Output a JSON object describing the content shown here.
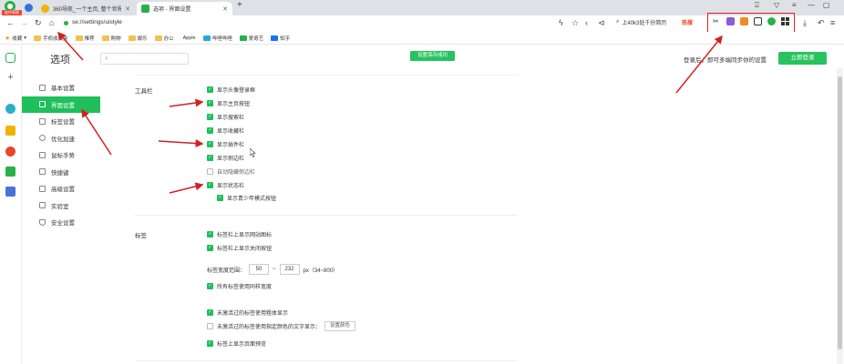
{
  "tabs": [
    {
      "title": "360导航_一个主页, 整个世界",
      "active": false
    },
    {
      "title": "选项 - 界面设置",
      "active": true
    }
  ],
  "browser_badge": "软件帮帮",
  "new_tab_symbol": "+",
  "address": "se://settings/uistyle",
  "search_box": "上40k3处千份简历",
  "hot_label": "热搜",
  "bookmarks": [
    {
      "label": "收藏",
      "type": "star"
    },
    {
      "label": "手机收藏夹",
      "type": "folder"
    },
    {
      "label": "推荐",
      "type": "folder"
    },
    {
      "label": "购物",
      "type": "folder"
    },
    {
      "label": "娱乐",
      "type": "folder"
    },
    {
      "label": "办公",
      "type": "folder"
    },
    {
      "label": "Apple",
      "type": "apple"
    },
    {
      "label": "哔哩哔哩",
      "type": "site"
    },
    {
      "label": "爱奇艺",
      "type": "site"
    },
    {
      "label": "知乎",
      "type": "site"
    }
  ],
  "settings": {
    "title": "选项",
    "search_placeholder": "",
    "save_toast": "设置保存成功",
    "login_tip": "登录后，即可多端同步你的设置",
    "login_button": "立即登录"
  },
  "nav": [
    {
      "label": "基本设置",
      "active": false
    },
    {
      "label": "界面设置",
      "active": true
    },
    {
      "label": "标签设置",
      "active": false
    },
    {
      "label": "优化加速",
      "active": false
    },
    {
      "label": "鼠标手势",
      "active": false
    },
    {
      "label": "快捷键",
      "active": false
    },
    {
      "label": "高级设置",
      "active": false
    },
    {
      "label": "实验室",
      "active": false
    },
    {
      "label": "安全设置",
      "active": false
    }
  ],
  "toolbar_section": {
    "label": "工具栏",
    "options": [
      {
        "label": "显示头像登录框",
        "checked": true
      },
      {
        "label": "显示主页按钮",
        "checked": true
      },
      {
        "label": "显示搜索栏",
        "checked": true
      },
      {
        "label": "显示收藏栏",
        "checked": true
      },
      {
        "label": "显示插件栏",
        "checked": true
      },
      {
        "label": "显示侧边栏",
        "checked": true
      },
      {
        "label": "自动隐藏侧边栏",
        "checked": false
      },
      {
        "label": "显示状态栏",
        "checked": true
      },
      {
        "label": "显示青少年模式按钮",
        "checked": true
      }
    ]
  },
  "tabs_section": {
    "label": "标签",
    "options": [
      {
        "label": "标签栏上显示网站图标",
        "checked": true
      },
      {
        "label": "标签栏上显示关闭按钮",
        "checked": true
      }
    ],
    "width_label": "标签宽度范围：",
    "width_min": "50",
    "width_sep": "~",
    "width_max": "232",
    "width_unit": "px（34~800）",
    "same_width": {
      "label": "所有标签使用同样宽度",
      "checked": true
    },
    "unvisited_bold": {
      "label": "未激活过的标签使用粗体显示",
      "checked": true
    },
    "unvisited_color": {
      "label": "未激活过的标签使用指定颜色的文字显示：",
      "checked": false
    },
    "set_color_button": "设置颜色",
    "preview": {
      "label": "标签上显示页面预览",
      "checked": true
    }
  },
  "colors": {
    "accent_green": "#1fbf5b",
    "annotation_red": "#e02020"
  }
}
